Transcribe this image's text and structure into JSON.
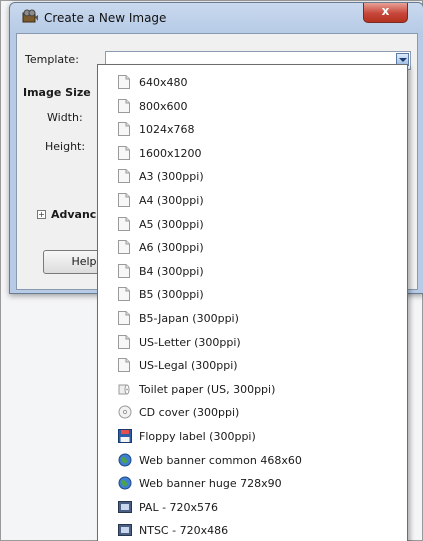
{
  "window": {
    "title": "Create a New Image",
    "close_label": "x"
  },
  "form": {
    "template_label": "Template:",
    "image_size_label": "Image Size",
    "width_label": "Width:",
    "height_label": "Height:",
    "advanced_label": "Advanc",
    "help_label": "Help"
  },
  "dropdown": {
    "items": [
      {
        "label": "640x480",
        "icon": "page-icon"
      },
      {
        "label": "800x600",
        "icon": "page-icon"
      },
      {
        "label": "1024x768",
        "icon": "page-icon"
      },
      {
        "label": "1600x1200",
        "icon": "page-icon"
      },
      {
        "label": "A3 (300ppi)",
        "icon": "page-icon"
      },
      {
        "label": "A4 (300ppi)",
        "icon": "page-icon"
      },
      {
        "label": "A5 (300ppi)",
        "icon": "page-icon"
      },
      {
        "label": "A6 (300ppi)",
        "icon": "page-icon"
      },
      {
        "label": "B4 (300ppi)",
        "icon": "page-icon"
      },
      {
        "label": "B5 (300ppi)",
        "icon": "page-icon"
      },
      {
        "label": "B5-Japan (300ppi)",
        "icon": "page-icon"
      },
      {
        "label": "US-Letter (300ppi)",
        "icon": "page-icon"
      },
      {
        "label": "US-Legal (300ppi)",
        "icon": "page-icon"
      },
      {
        "label": "Toilet paper (US, 300ppi)",
        "icon": "toilet-paper-icon"
      },
      {
        "label": "CD cover (300ppi)",
        "icon": "cd-icon"
      },
      {
        "label": "Floppy label (300ppi)",
        "icon": "floppy-icon"
      },
      {
        "label": "Web banner common 468x60",
        "icon": "globe-icon"
      },
      {
        "label": "Web banner huge 728x90",
        "icon": "globe-icon"
      },
      {
        "label": "PAL - 720x576",
        "icon": "tv-icon"
      },
      {
        "label": "NTSC - 720x486",
        "icon": "tv-icon"
      }
    ]
  }
}
